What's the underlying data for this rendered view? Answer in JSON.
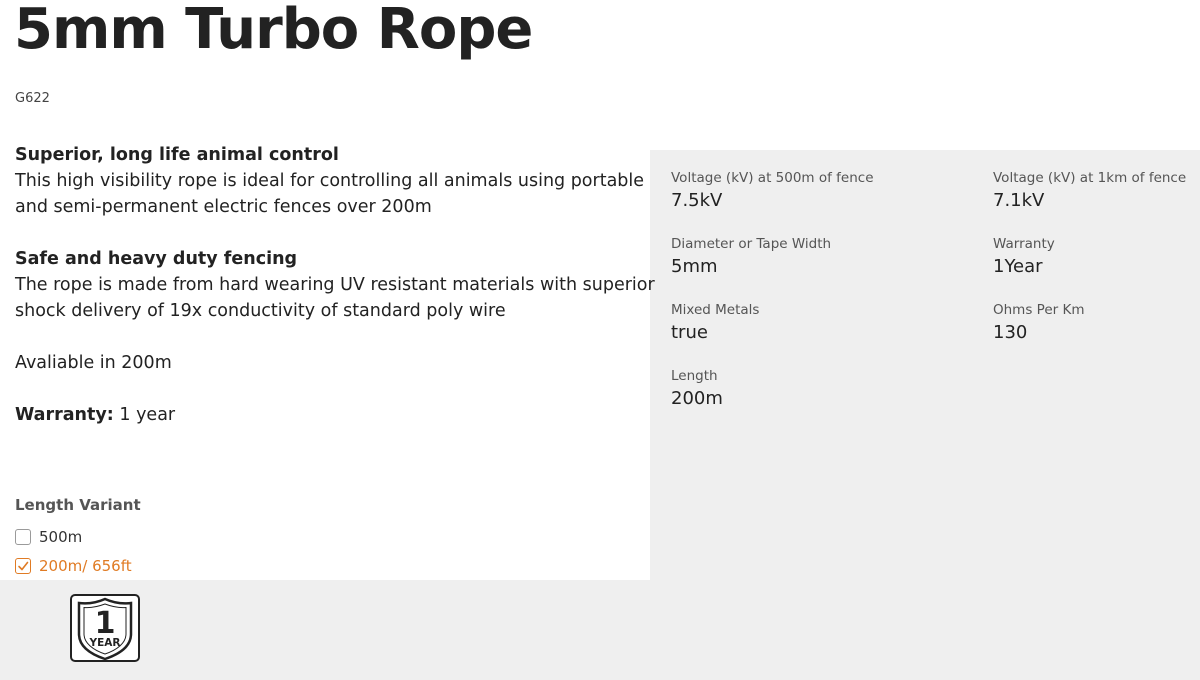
{
  "product": {
    "title": "5mm Turbo Rope",
    "sku": "G622"
  },
  "description": {
    "section1_heading": "Superior, long life animal control",
    "section1_text": "This high visibility rope is ideal for controlling all animals using portable and semi-permanent electric fences over 200m",
    "section2_heading": "Safe and heavy duty fencing",
    "section2_text": "The rope is made from hard wearing UV resistant materials with superior shock delivery of 19x conductivity of standard poly wire",
    "availability": "Avaliable in 200m",
    "warranty_label": "Warranty:",
    "warranty_value": "1 year"
  },
  "variant": {
    "label": "Length Variant",
    "options": [
      {
        "label": "500m",
        "selected": false
      },
      {
        "label": "200m/ 656ft",
        "selected": true
      }
    ]
  },
  "specs": [
    {
      "label": "Voltage (kV) at 500m of fence",
      "value": "7.5kV"
    },
    {
      "label": "Voltage (kV) at 1km of fence",
      "value": "7.1kV"
    },
    {
      "label": "Diameter or Tape Width",
      "value": "5mm"
    },
    {
      "label": "Warranty",
      "value": "1Year"
    },
    {
      "label": "Mixed Metals",
      "value": "true"
    },
    {
      "label": "Ohms Per Km",
      "value": "130"
    },
    {
      "label": "Length",
      "value": "200m"
    }
  ],
  "badge": {
    "icon": "warranty-badge-icon",
    "number": "1",
    "text": "YEAR"
  },
  "colors": {
    "accent": "#e07b24",
    "panel": "#efefef"
  }
}
